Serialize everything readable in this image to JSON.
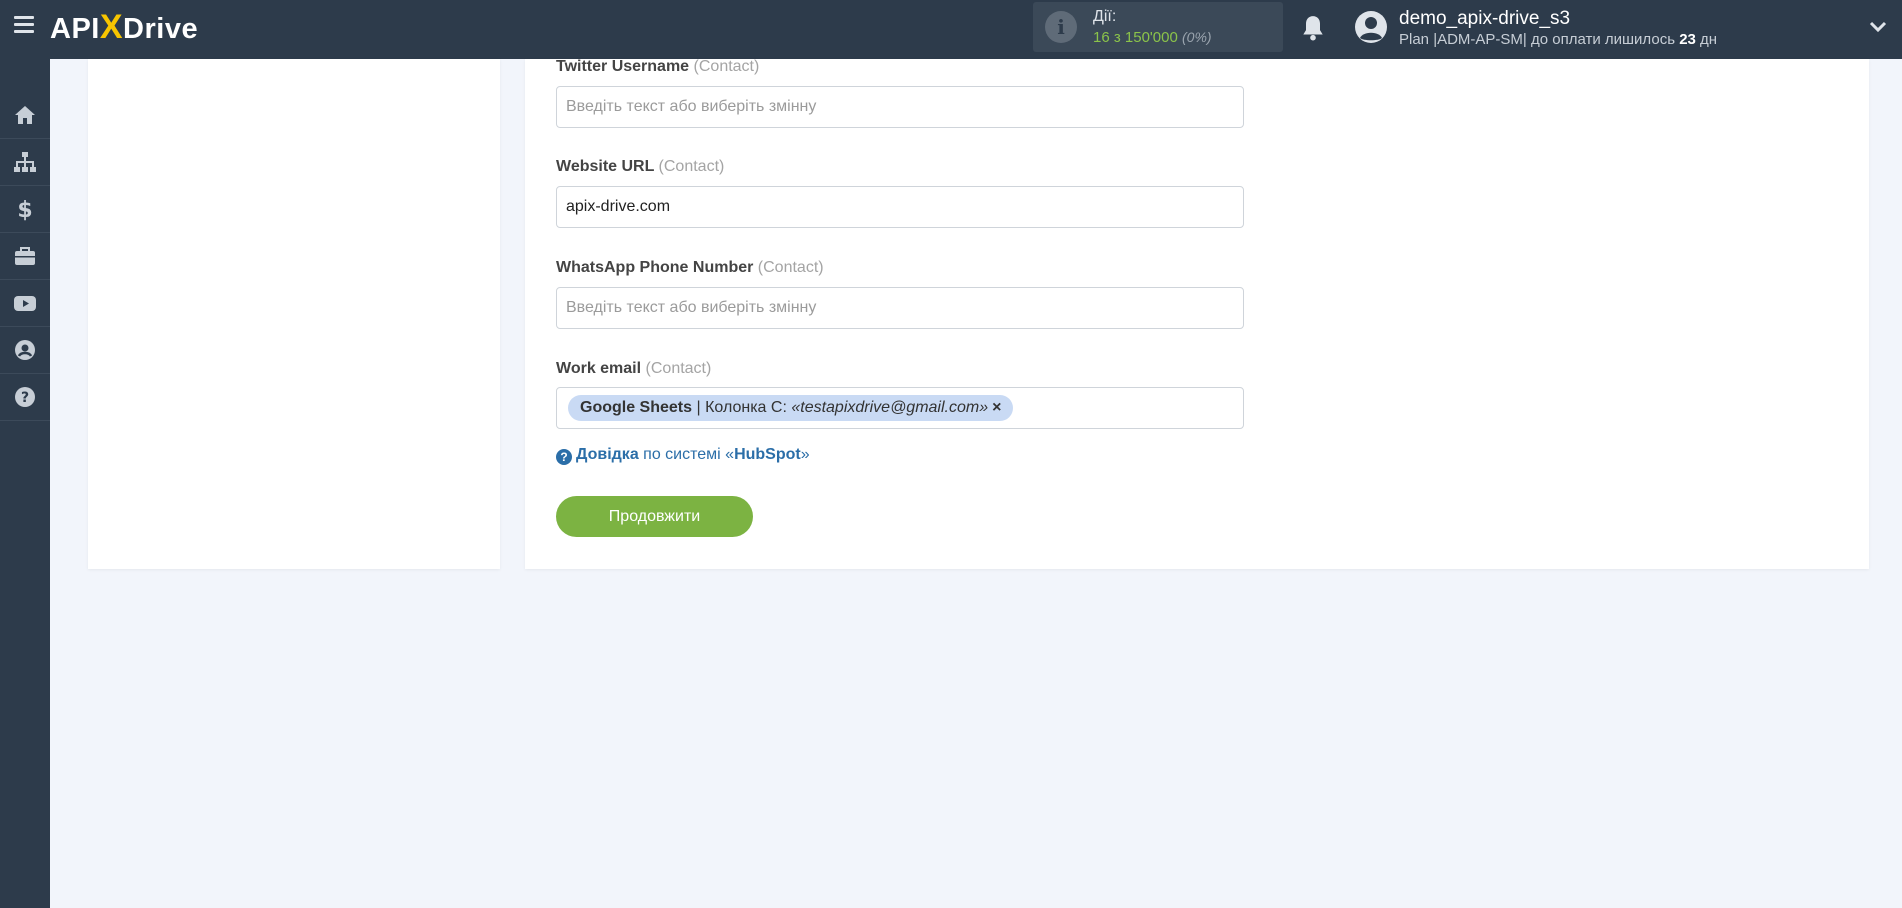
{
  "header": {
    "logo_left": "API",
    "logo_x": "X",
    "logo_right": "Drive",
    "actions_label": "Дії:",
    "actions_count": "16 з 150'000",
    "actions_percent": "(0%)",
    "user_name": "demo_apix-drive_s3",
    "plan_text": "Plan |ADM-AP-SM| до оплати лишилось",
    "days_value": "23",
    "days_unit": "дн"
  },
  "sidebar": {
    "items": [
      {
        "icon": "home-icon"
      },
      {
        "icon": "sitemap-icon"
      },
      {
        "icon": "dollar-icon"
      },
      {
        "icon": "briefcase-icon"
      },
      {
        "icon": "youtube-icon"
      },
      {
        "icon": "user-circle-icon"
      },
      {
        "icon": "question-circle-icon"
      }
    ]
  },
  "form": {
    "placeholder": "Введіть текст або виберіть змінну",
    "fields": [
      {
        "label": "Twitter Username",
        "sub": "(Contact)",
        "value": ""
      },
      {
        "label": "Website URL",
        "sub": "(Contact)",
        "value": "apix-drive.com"
      },
      {
        "label": "WhatsApp Phone Number",
        "sub": "(Contact)",
        "value": ""
      },
      {
        "label": "Work email",
        "sub": "(Contact)"
      }
    ],
    "work_email_tag": {
      "source": "Google Sheets",
      "column": " | Колонка С: ",
      "value": "«testapixdrive@gmail.com»",
      "remove": "×"
    },
    "help": {
      "link": "Довідка",
      "middle": " по системі «",
      "system": "HubSpot",
      "end": "»"
    },
    "continue_label": "Продовжити"
  },
  "colors": {
    "topbar": "#2d3b4b",
    "accent_green": "#7cb342",
    "logo_yellow": "#f7c500",
    "link_blue": "#2b6ea8"
  }
}
